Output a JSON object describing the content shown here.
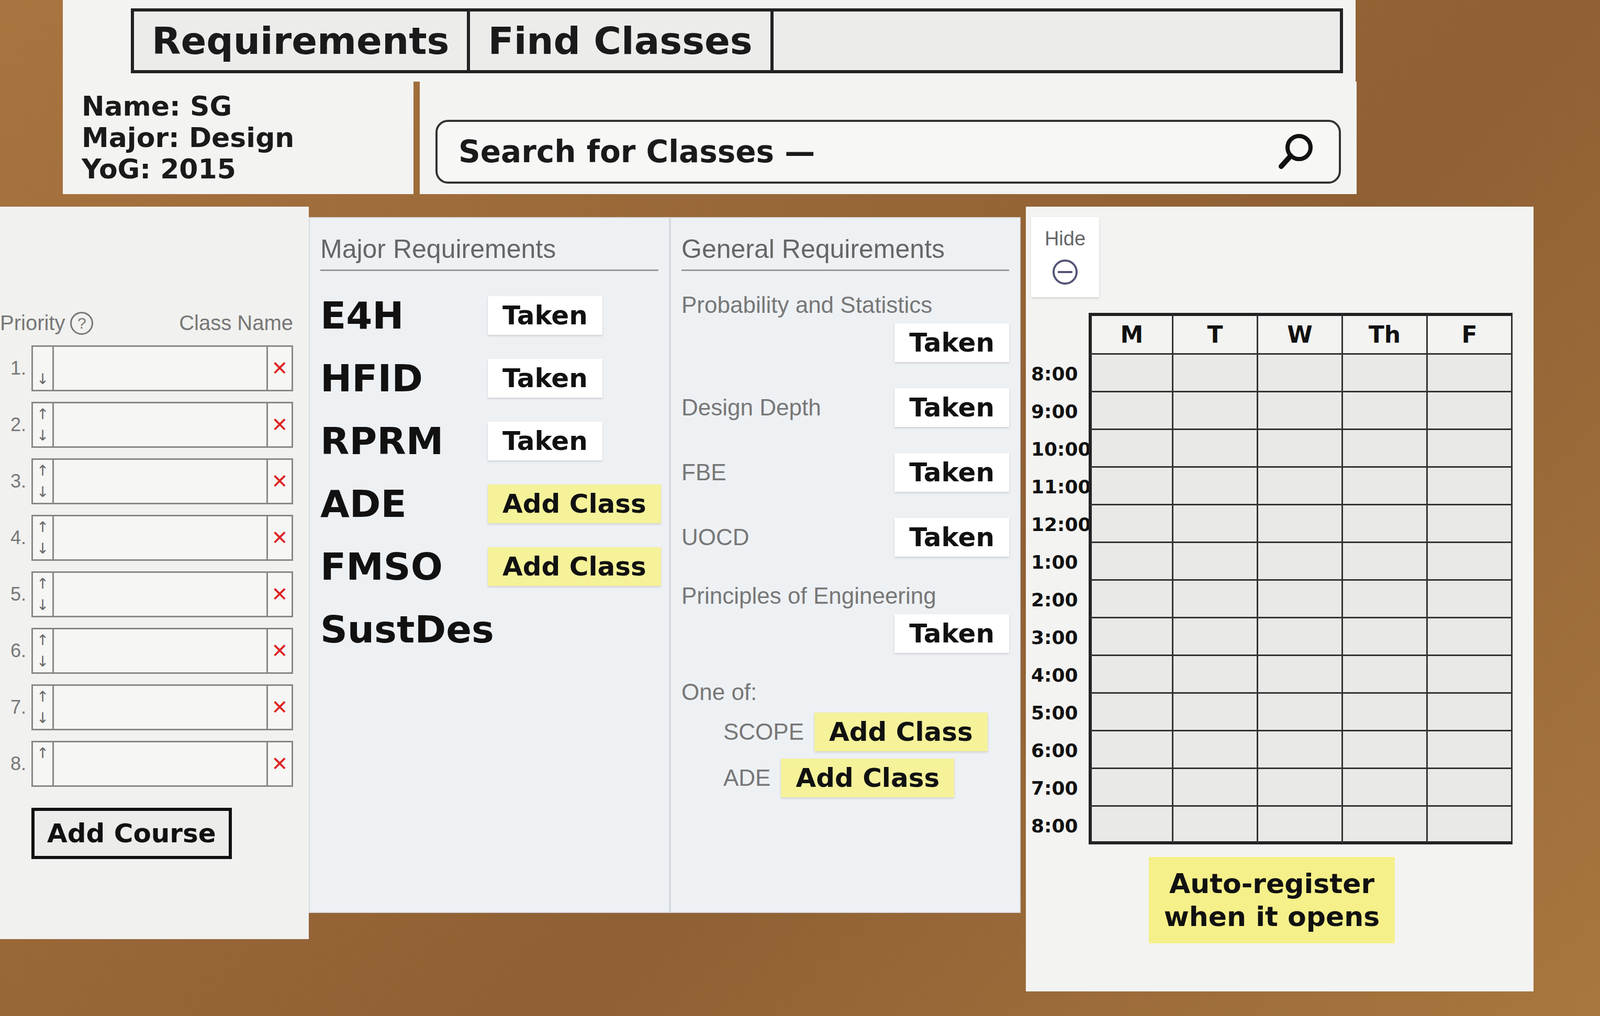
{
  "tabs": [
    {
      "label": "Requirements"
    },
    {
      "label": "Find Classes"
    }
  ],
  "profile": {
    "lines": [
      "Name: SG",
      "Major: Design",
      "YoG: 2015"
    ]
  },
  "search": {
    "placeholder": "Search for Classes —"
  },
  "priority_list": {
    "header": {
      "priority": "Priority",
      "help": "?",
      "class_name": "Class Name"
    },
    "up_glyph": "↑",
    "down_glyph": "↓",
    "remove_glyph": "✕",
    "rows": [
      {
        "index": "1.",
        "class_name": "",
        "can_move_up": false,
        "can_move_down": true
      },
      {
        "index": "2.",
        "class_name": "",
        "can_move_up": true,
        "can_move_down": true
      },
      {
        "index": "3.",
        "class_name": "",
        "can_move_up": true,
        "can_move_down": true
      },
      {
        "index": "4.",
        "class_name": "",
        "can_move_up": true,
        "can_move_down": true
      },
      {
        "index": "5.",
        "class_name": "",
        "can_move_up": true,
        "can_move_down": true
      },
      {
        "index": "6.",
        "class_name": "",
        "can_move_up": true,
        "can_move_down": true
      },
      {
        "index": "7.",
        "class_name": "",
        "can_move_up": true,
        "can_move_down": true
      },
      {
        "index": "8.",
        "class_name": "",
        "can_move_up": true,
        "can_move_down": false
      }
    ],
    "add_button": "Add Course"
  },
  "major": {
    "title": "Major Requirements",
    "items": [
      {
        "name": "E4H",
        "kind": "taken",
        "action": "Taken"
      },
      {
        "name": "HFID",
        "kind": "taken",
        "action": "Taken"
      },
      {
        "name": "RPRM",
        "kind": "taken",
        "action": "Taken"
      },
      {
        "name": "ADE",
        "kind": "add",
        "action": "Add Class"
      },
      {
        "name": "FMSO",
        "kind": "add",
        "action": "Add Class"
      },
      {
        "name": "SustDes",
        "kind": "none"
      }
    ]
  },
  "general": {
    "title": "General Requirements",
    "items": [
      {
        "name": "Probability and Statistics",
        "kind": "taken",
        "action": "Taken"
      },
      {
        "name": "Design Depth",
        "kind": "taken",
        "action": "Taken"
      },
      {
        "name": "FBE",
        "kind": "taken",
        "action": "Taken"
      },
      {
        "name": "UOCD",
        "kind": "taken",
        "action": "Taken"
      },
      {
        "name": "Principles of Engineering",
        "kind": "taken",
        "action": "Taken"
      }
    ],
    "group": {
      "label": "One of:",
      "options": [
        {
          "name": "SCOPE",
          "kind": "add",
          "action": "Add Class"
        },
        {
          "name": "ADE",
          "kind": "add",
          "action": "Add Class"
        }
      ]
    }
  },
  "calendar": {
    "hide_label": "Hide",
    "days": [
      "M",
      "T",
      "W",
      "Th",
      "F"
    ],
    "times": [
      "8:00",
      "9:00",
      "10:00",
      "11:00",
      "12:00",
      "1:00",
      "2:00",
      "3:00",
      "4:00",
      "5:00",
      "6:00",
      "7:00",
      "8:00"
    ]
  },
  "note": "Auto-register when it opens"
}
